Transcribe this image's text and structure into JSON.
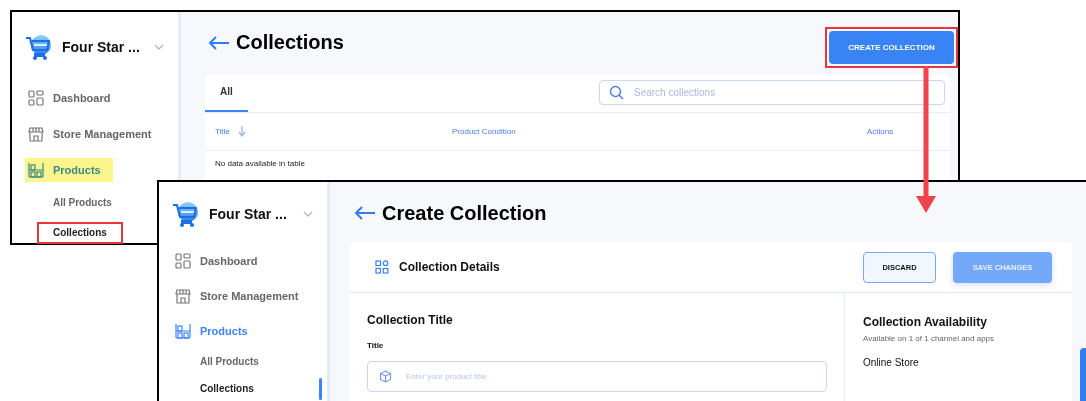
{
  "screens": [
    {
      "kind": "list",
      "store_name": "Four Star ...",
      "nav": [
        {
          "label": "Dashboard",
          "kind": "dashboard",
          "selected": false,
          "highlighted": false
        },
        {
          "label": "Store Management",
          "kind": "store",
          "selected": false,
          "highlighted": false
        },
        {
          "label": "Products",
          "kind": "products",
          "selected": true,
          "highlighted": true,
          "children": [
            {
              "label": "All Products",
              "selected": false,
              "boxed": false
            },
            {
              "label": "Collections",
              "selected": true,
              "boxed": true
            }
          ]
        }
      ],
      "title": "Collections",
      "create_button": {
        "label": "CREATE COLLECTION",
        "boxed": true
      },
      "tabs": [
        {
          "label": "All",
          "selected": true
        }
      ],
      "search": {
        "placeholder": "Search collections"
      },
      "table": {
        "columns": [
          {
            "label": "Title",
            "sortable": true
          },
          {
            "label": "Product Condition",
            "sortable": false
          },
          {
            "label": "Actions",
            "sortable": false
          }
        ],
        "empty_text": "No data available in table"
      }
    },
    {
      "kind": "create",
      "store_name": "Four Star ...",
      "nav": [
        {
          "label": "Dashboard",
          "kind": "dashboard",
          "selected": false,
          "highlighted": false
        },
        {
          "label": "Store Management",
          "kind": "store",
          "selected": false,
          "highlighted": false
        },
        {
          "label": "Products",
          "kind": "products",
          "selected": true,
          "highlighted": false,
          "children": [
            {
              "label": "All Products",
              "selected": false,
              "boxed": false
            },
            {
              "label": "Collections",
              "selected": true,
              "boxed": false
            }
          ]
        }
      ],
      "title": "Create Collection",
      "section_title": "Collection Details",
      "buttons": [
        {
          "label": "DISCARD",
          "kind": "secondary"
        },
        {
          "label": "SAVE CHANGES",
          "kind": "primary"
        }
      ],
      "form": {
        "heading": "Collection Title",
        "field_label": "Title",
        "placeholder": "Enter your product title"
      },
      "availability": {
        "heading": "Collection Availability",
        "subtitle": "Available on 1 of 1 channel and apps",
        "channel": "Online Store"
      }
    }
  ]
}
